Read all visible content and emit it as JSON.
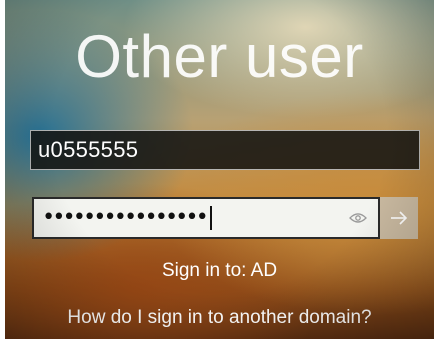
{
  "screen": {
    "title": "Other user"
  },
  "username_field": {
    "value": "u0555555"
  },
  "password_field": {
    "value": "••••••••••••••••"
  },
  "sign_in_domain": {
    "text": "Sign in to: AD"
  },
  "other_domain_link": {
    "text": "How do I sign in to another domain?"
  },
  "icons": {
    "reveal": "eye-icon",
    "submit": "arrow-right-icon"
  },
  "colors": {
    "username_bg": "#141412",
    "password_bg": "#f3f4f0",
    "submit_bg": "#c9b9a0",
    "text": "#ffffff"
  }
}
